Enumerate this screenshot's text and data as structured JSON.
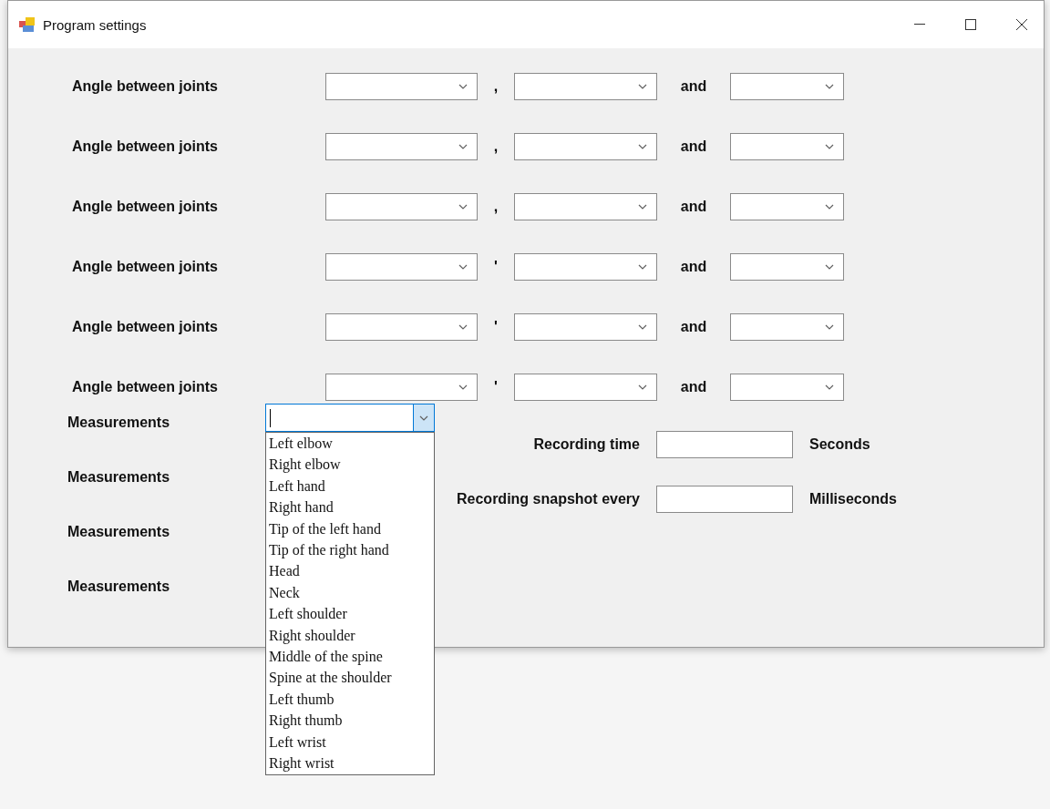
{
  "window": {
    "title": "Program settings"
  },
  "angle_rows": [
    {
      "label": "Angle between joints",
      "separator": ",",
      "conjunction": "and"
    },
    {
      "label": "Angle between joints",
      "separator": ",",
      "conjunction": "and"
    },
    {
      "label": "Angle between joints",
      "separator": ",",
      "conjunction": "and"
    },
    {
      "label": "Angle between joints",
      "separator": "'",
      "conjunction": "and"
    },
    {
      "label": "Angle between joints",
      "separator": "'",
      "conjunction": "and"
    },
    {
      "label": "Angle between joints",
      "separator": "'",
      "conjunction": "and"
    }
  ],
  "measurement_rows": [
    {
      "label": "Measurements"
    },
    {
      "label": "Measurements"
    },
    {
      "label": "Measurements"
    },
    {
      "label": "Measurements"
    }
  ],
  "open_dropdown": {
    "expanded": true,
    "options": [
      "Left elbow",
      "Right elbow",
      "Left hand",
      "Right hand",
      "Tip of the left hand",
      "Tip of the right hand",
      "Head",
      "Neck",
      "Left shoulder",
      "Right shoulder",
      "Middle of the spine",
      "Spine at the shoulder",
      "Left thumb",
      "Right thumb",
      "Left wrist",
      "Right wrist"
    ]
  },
  "recording": [
    {
      "label": "Recording time",
      "unit": "Seconds"
    },
    {
      "label": "Recording snapshot every",
      "unit": "Milliseconds"
    }
  ]
}
